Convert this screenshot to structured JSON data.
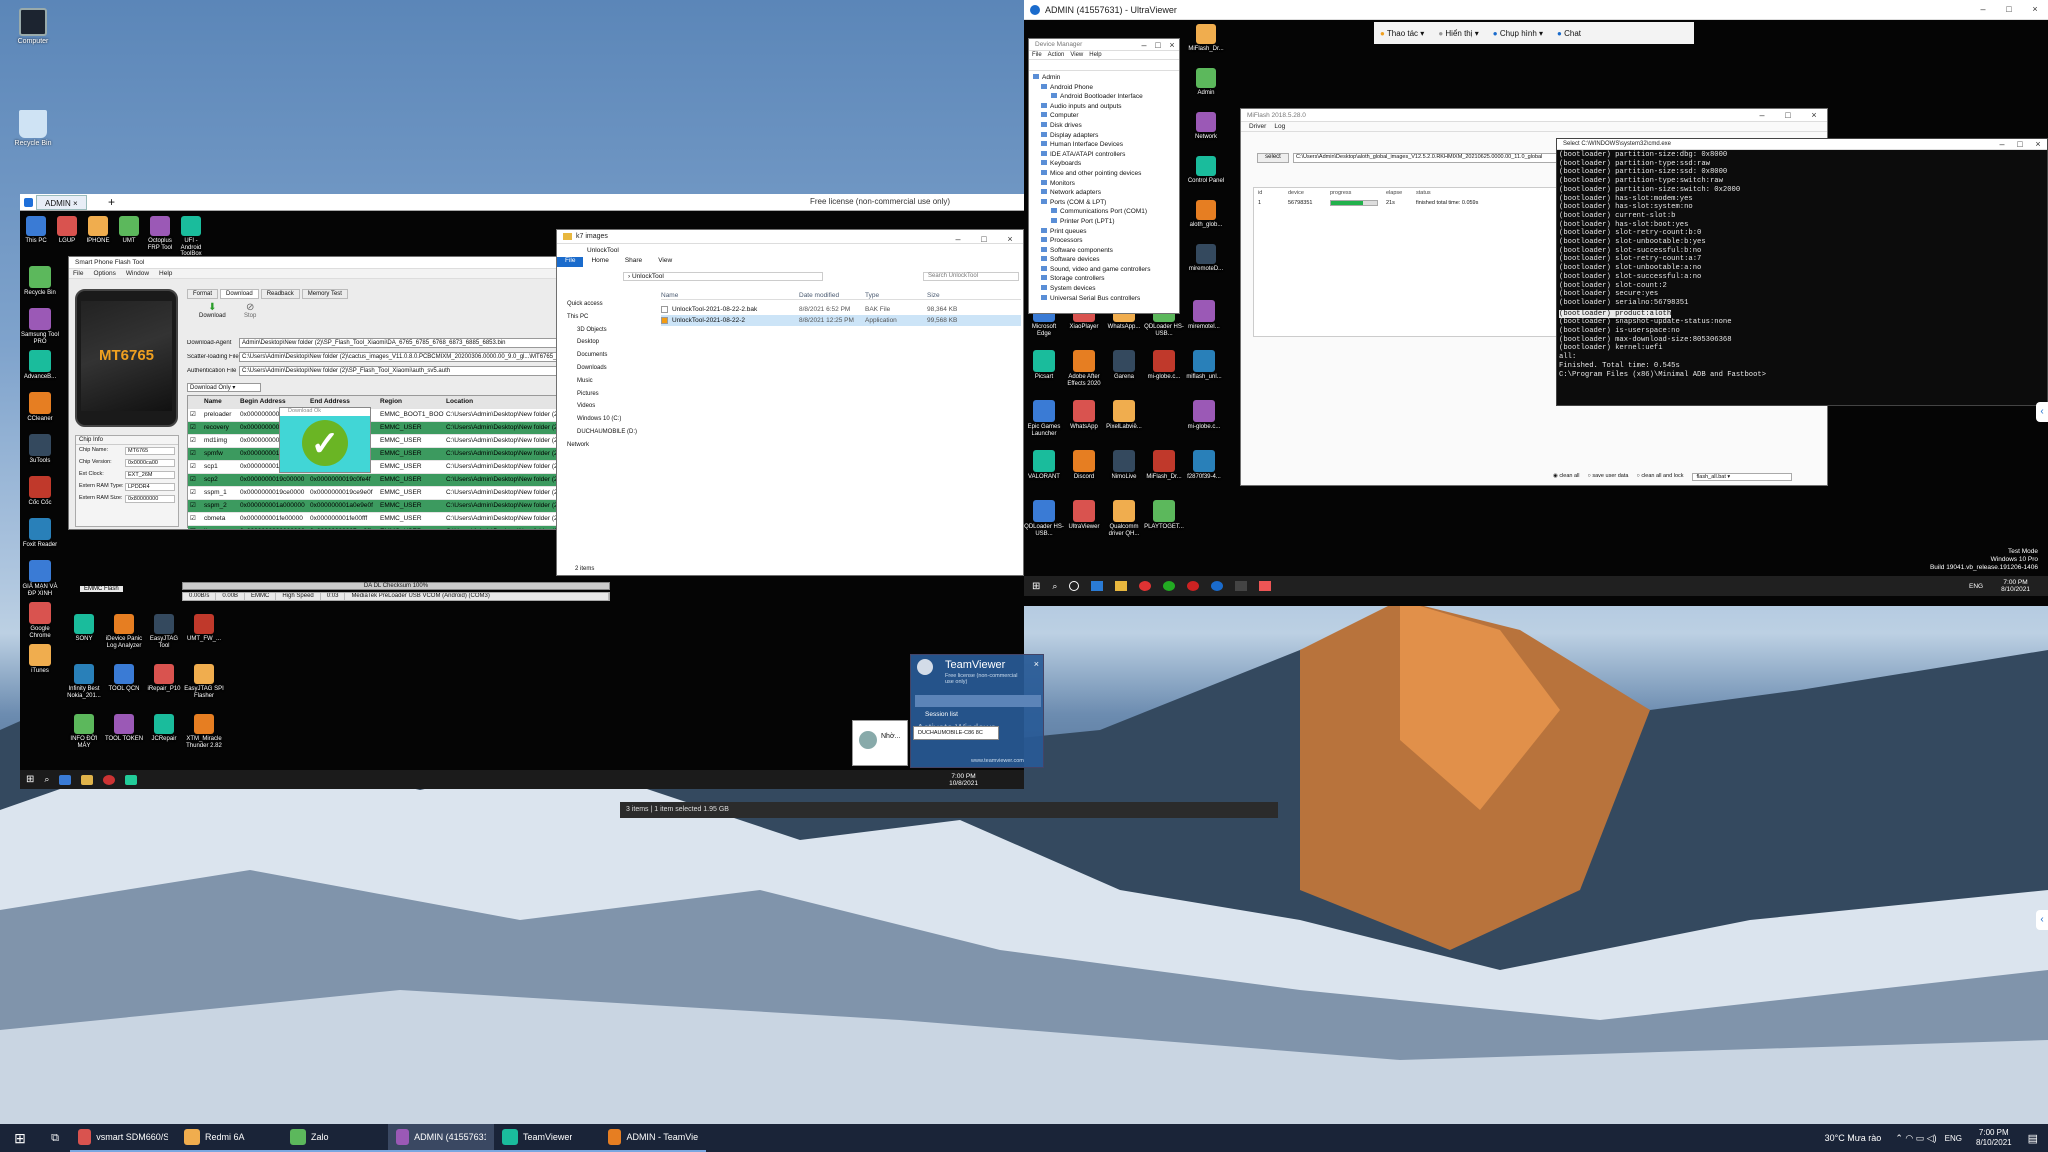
{
  "host_desktop": {
    "icons": [
      {
        "label": "Computer"
      },
      {
        "label": "Recycle Bin"
      }
    ]
  },
  "ultraviewer": {
    "title": "ADMIN (41557631) - UltraViewer",
    "toolbar": [
      "Thao tác",
      "Hiển thị",
      "Chụp hình",
      "Chat"
    ]
  },
  "remote_left": {
    "tab": "ADMIN",
    "banner": "Free license (non-commercial use only)",
    "icons_top": [
      "This PC",
      "LGUP",
      "IPHONE",
      "UMT",
      "Octoplus FRP Tool",
      "UFI - Android ToolBox"
    ],
    "icons_left": [
      "Recycle Bin",
      "Samsung Tool PRO",
      "AdvanceB...",
      "CCleaner",
      "3uTools",
      "Cốc Cốc",
      "Foxit Reader",
      "GIẢ MẠN VÀ ĐP XINH",
      "Google Chrome",
      "iTunes"
    ],
    "icons_bottom": [
      "SONY",
      "iDevice Panic Log Analyzer",
      "EasyJTAG Tool",
      "UMT_FW_...",
      "Infinity Best Nokia_201...",
      "TOOL QCN",
      "iRepair_P10",
      "EasyJTAG SPI Flasher",
      "INFO ĐỜI MÁY",
      "TOOL TOKEN",
      "JCRepair",
      "XTM_Miracle Thunder 2.82"
    ],
    "taskbar_time": "7:00 PM",
    "taskbar_date": "10/8/2021"
  },
  "sp_flash": {
    "title": "Smart Phone Flash Tool",
    "menu": [
      "File",
      "Options",
      "Window",
      "Help"
    ],
    "tabs": [
      "Format",
      "Download",
      "Readback",
      "Memory Test"
    ],
    "buttons": [
      "Download",
      "Stop"
    ],
    "chip": "MT6765",
    "fields": [
      {
        "label": "Download-Agent",
        "value": "Admin\\Desktop\\New folder (2)\\SP_Flash_Tool_Xiaomi\\DA_6765_6785_6768_6873_6885_6853.bin"
      },
      {
        "label": "Scatter-loading File",
        "value": "C:\\Users\\Admin\\Desktop\\New folder (2)\\cactus_images_V11.0.8.0.PCBCMIXM_20200306.0000.00_9.0_gl...\\MT6765_Android_scatter.txt"
      },
      {
        "label": "Authentication File",
        "value": "C:\\Users\\Admin\\Desktop\\New folder (2)\\SP_Flash_Tool_Xiaomi\\auth_sv5.auth"
      }
    ],
    "mode": "Download Only",
    "table_headers": [
      "",
      "Name",
      "Begin Address",
      "End Address",
      "Region",
      "Location"
    ],
    "rows": [
      {
        "name": "preloader",
        "begin": "0x0000000000000000",
        "end": "0x000000000003c00",
        "region": "EMMC_BOOT1_BOOT2",
        "loc": "C:\\Users\\Admin\\Desktop\\New folder (2)\\cactu",
        "g": false
      },
      {
        "name": "recovery",
        "begin": "0x0000000008000000",
        "end": "0x0000000009fffff",
        "region": "EMMC_USER",
        "loc": "C:\\Users\\Admin\\Desktop\\New folder (2)\\cactu",
        "g": true
      },
      {
        "name": "md1img",
        "begin": "0x000000000b000000",
        "end": "0x000000000cffff",
        "region": "EMMC_USER",
        "loc": "C:\\Users\\Admin\\Desktop\\New folder (2)\\cactu",
        "g": false
      },
      {
        "name": "spmfw",
        "begin": "0x0000000011b00000",
        "end": "0x0000000011b0ffff",
        "region": "EMMC_USER",
        "loc": "C:\\Users\\Admin\\Desktop\\New folder (2)\\cactu",
        "g": true
      },
      {
        "name": "scp1",
        "begin": "0x0000000012000000",
        "end": "0x00000000120fffff",
        "region": "EMMC_USER",
        "loc": "C:\\Users\\Admin\\Desktop\\New folder (2)\\cactu",
        "g": false
      },
      {
        "name": "scp2",
        "begin": "0x0000000019c00000",
        "end": "0x0000000019c0fe4f",
        "region": "EMMC_USER",
        "loc": "C:\\Users\\Admin\\Desktop\\New folder (2)\\cactu",
        "g": true
      },
      {
        "name": "sspm_1",
        "begin": "0x0000000019ce0000",
        "end": "0x0000000019ce9e0f",
        "region": "EMMC_USER",
        "loc": "C:\\Users\\Admin\\Desktop\\New folder (2)\\cactu",
        "g": false
      },
      {
        "name": "sspm_2",
        "begin": "0x000000001a000000",
        "end": "0x000000001a0e9e0f",
        "region": "EMMC_USER",
        "loc": "C:\\Users\\Admin\\Desktop\\New folder (2)\\cactu",
        "g": true
      },
      {
        "name": "cbmeta",
        "begin": "0x000000001fe00000",
        "end": "0x000000001fe00fff",
        "region": "EMMC_USER",
        "loc": "C:\\Users\\Admin\\Desktop\\New folder (2)\\cactu",
        "g": false
      },
      {
        "name": "lk",
        "begin": "0x0000000020000000",
        "end": "0x00000000207ce9ff",
        "region": "EMMC_USER",
        "loc": "C:\\Users\\Admin\\Desktop\\New folder (2)\\cactu",
        "g": true
      },
      {
        "name": "lk2",
        "begin": "0x0000000020700000",
        "end": "0x00000000202ce9ff",
        "region": "EMMC_USER",
        "loc": "C:\\Users\\Admin\\Desktop\\New folder (2)\\cactu",
        "g": false
      },
      {
        "name": "boot",
        "begin": "0x0000000020800000",
        "end": "0x00000000218fffff",
        "region": "EMMC_USER",
        "loc": "C:\\Users\\Admin\\Desktop\\New folder (2)\\cactu",
        "g": true
      }
    ],
    "chip_info_title": "Chip Info",
    "chip_info": [
      {
        "k": "Chip Name:",
        "v": "MT6765"
      },
      {
        "k": "Chip Version:",
        "v": "0x0000ca00"
      },
      {
        "k": "Ext Clock:",
        "v": "EXT_26M"
      },
      {
        "k": "Extern RAM Type:",
        "v": "LPDDR4"
      },
      {
        "k": "Extern RAM Size:",
        "v": "0x80000000"
      }
    ],
    "emmc": "EMMC Flash",
    "progress": "DA DL Checksum 100%",
    "status": [
      "0.00B/s",
      "0.00B",
      "EMMC",
      "High Speed",
      "0:03",
      "MediaTek PreLoader USB VCOM (Android) (COM3)"
    ],
    "popup": "Download Ok"
  },
  "explorer": {
    "title": "k7 images",
    "path": "UnlockTool",
    "search": "Search UnlockTool",
    "ribbon": [
      "File",
      "Home",
      "Share",
      "View"
    ],
    "nav": [
      "Quick access",
      "This PC",
      "3D Objects",
      "Desktop",
      "Documents",
      "Downloads",
      "Music",
      "Pictures",
      "Videos",
      "Windows 10 (C:)",
      "DUCHAUMOBILE (D:)",
      "Network"
    ],
    "headers": [
      "Name",
      "Date modified",
      "Type",
      "Size"
    ],
    "files": [
      {
        "name": "UnlockTool-2021-08-22-2.bak",
        "date": "8/8/2021 6:52 PM",
        "type": "BAK File",
        "size": "98,364 KB"
      },
      {
        "name": "UnlockTool-2021-08-22-2",
        "date": "8/8/2021 12:25 PM",
        "type": "Application",
        "size": "99,568 KB"
      }
    ],
    "count": "2 items",
    "status": "3 items  |  1 item selected  1.95 GB"
  },
  "device_manager": {
    "title": "Device Manager",
    "menu": [
      "File",
      "Action",
      "View",
      "Help"
    ],
    "tree": [
      "Admin",
      "Android Phone",
      "Android Bootloader Interface",
      "Audio inputs and outputs",
      "Computer",
      "Disk drives",
      "Display adapters",
      "Human Interface Devices",
      "IDE ATA/ATAPI controllers",
      "Keyboards",
      "Mice and other pointing devices",
      "Monitors",
      "Network adapters",
      "Ports (COM & LPT)",
      "Communications Port (COM1)",
      "Printer Port (LPT1)",
      "Print queues",
      "Processors",
      "Software components",
      "Software devices",
      "Sound, video and game controllers",
      "Storage controllers",
      "System devices",
      "Universal Serial Bus controllers"
    ]
  },
  "miflash": {
    "title": "MiFlash 2018.5.28.0",
    "menu": [
      "Driver",
      "Log"
    ],
    "select": "select",
    "path": "C:\\Users\\Admin\\Desktop\\aloth_global_images_V12.5.2.0.RKHMIXM_20210625.0000.00_11.0_global",
    "headers": [
      "id",
      "device",
      "progress",
      "elapse",
      "status"
    ],
    "row": {
      "id": "1",
      "device": "56798351",
      "elapse": "21s",
      "status": "finished total time: 0.059s"
    },
    "progress_pct": 70,
    "options": [
      "clean all",
      "save user data",
      "clean all and lock"
    ],
    "script": "flash_all.bat"
  },
  "cmd": {
    "title": "Select C:\\WINDOWS\\system32\\cmd.exe",
    "lines": [
      "(bootloader) partition-size:dbg: 0x8000",
      "(bootloader) partition-type:ssd:raw",
      "(bootloader) partition-size:ssd: 0x8000",
      "(bootloader) partition-type:switch:raw",
      "(bootloader) partition-size:switch: 0x2000",
      "(bootloader) has-slot:modem:yes",
      "(bootloader) has-slot:system:no",
      "(bootloader) current-slot:b",
      "(bootloader) has-slot:boot:yes",
      "(bootloader) slot-retry-count:b:0",
      "(bootloader) slot-unbootable:b:yes",
      "(bootloader) slot-successful:b:no",
      "(bootloader) slot-retry-count:a:7",
      "(bootloader) slot-unbootable:a:no",
      "(bootloader) slot-successful:a:no",
      "(bootloader) slot-count:2",
      "(bootloader) secure:yes",
      "(bootloader) serialno:56798351",
      "(bootloader) product:aloth",
      "(bootloader) snapshot-update-status:none",
      "(bootloader) is-userspace:no",
      "(bootloader) max-download-size:805306368",
      "(bootloader) kernel:uefi",
      "all:",
      "Finished. Total time: 0.545s",
      "",
      "C:\\Program Files (x86)\\Minimal ADB and Fastboot>"
    ]
  },
  "remote_right": {
    "icons_col1": [
      "MiFlash_Dr...",
      "Admin",
      "Network",
      "Control Panel",
      "aloth_glob...",
      "miremoteD..."
    ],
    "icons_grid": [
      [
        "Microsoft Edge",
        "XiaoPlayer",
        "WhatsApp...",
        "QDLoader HS-USB...",
        "miremoteI..."
      ],
      [
        "Picsart",
        "Adobe After Effects 2020",
        "Garena",
        "mi-globe.c...",
        "miflash_unl..."
      ],
      [
        "Epic Games Launcher",
        "WhatsApp",
        "PixelLabvië...",
        "",
        "mi-globe.c..."
      ],
      [
        "VALORANT",
        "Discord",
        "NimoLive",
        "MiFlash_Dr...",
        "f2870f39-4..."
      ],
      [
        "QDLoader HS-USB...",
        "UltraViewer",
        "Qualcomm driver QH...",
        "PLAYTOGET...",
        ""
      ]
    ],
    "watermark": [
      "Test Mode",
      "Windows 10 Pro",
      "Build 19041.vb_release.191206-1406"
    ],
    "time": "7:00 PM",
    "date": "8/10/2021",
    "lang": "ENG"
  },
  "teamviewer": {
    "title": "TeamViewer",
    "sub": "Free license (non-commercial use only)",
    "session": "Session list",
    "session_item": "DUCHAUMOBILE-C86 8C",
    "activate": "Activate Windows",
    "url": "www.teamviewer.com",
    "notif": "Nhờ..."
  },
  "host_taskbar": {
    "items": [
      "vsmart SDM660/SD...",
      "Redmi 6A",
      "Zalo",
      "ADMIN (41557631) ...",
      "TeamViewer",
      "ADMIN - TeamView..."
    ],
    "weather": "30°C  Mưa rào",
    "lang": "ENG",
    "time": "7:00 PM",
    "date": "8/10/2021"
  }
}
